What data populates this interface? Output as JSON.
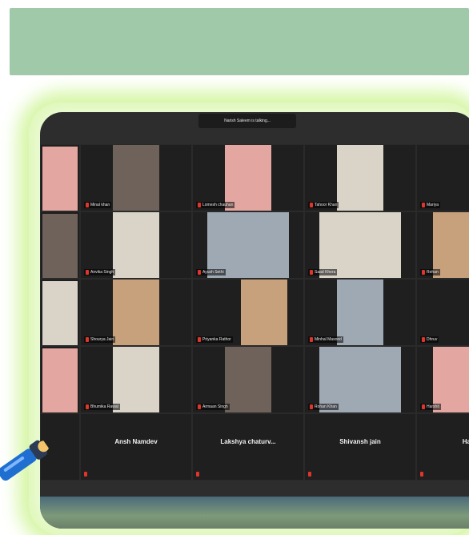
{
  "meeting": {
    "speaker_banner": "Narish Saleem is talking..."
  },
  "participants": [
    {
      "name": "Minal khan"
    },
    {
      "name": "Lomesh chauhan"
    },
    {
      "name": "Tahoor Khan"
    },
    {
      "name": "Mariya"
    },
    {
      "name": "Anvika Singh"
    },
    {
      "name": "Ayush Sethi"
    },
    {
      "name": "Saad Khera"
    },
    {
      "name": "Rehan"
    },
    {
      "name": "Shourya Jain"
    },
    {
      "name": "Priyanka Rathor"
    },
    {
      "name": "Minhal Masood"
    },
    {
      "name": "Dhruv"
    },
    {
      "name": "Bhumika Rawat"
    },
    {
      "name": "Armaan Singh"
    },
    {
      "name": "Rohan Khan"
    },
    {
      "name": "Harshit"
    },
    {
      "name": "Ansh Namdev"
    },
    {
      "name": "Lakshya  chaturv..."
    },
    {
      "name": "Shivansh jain"
    },
    {
      "name": "Ha"
    }
  ],
  "colors": {
    "mic_muted": "#e0352b",
    "banner": "#9fc9a8",
    "glow": "#d6f6a6"
  },
  "icons": [
    "mic-muted-icon",
    "flashlight-icon"
  ]
}
